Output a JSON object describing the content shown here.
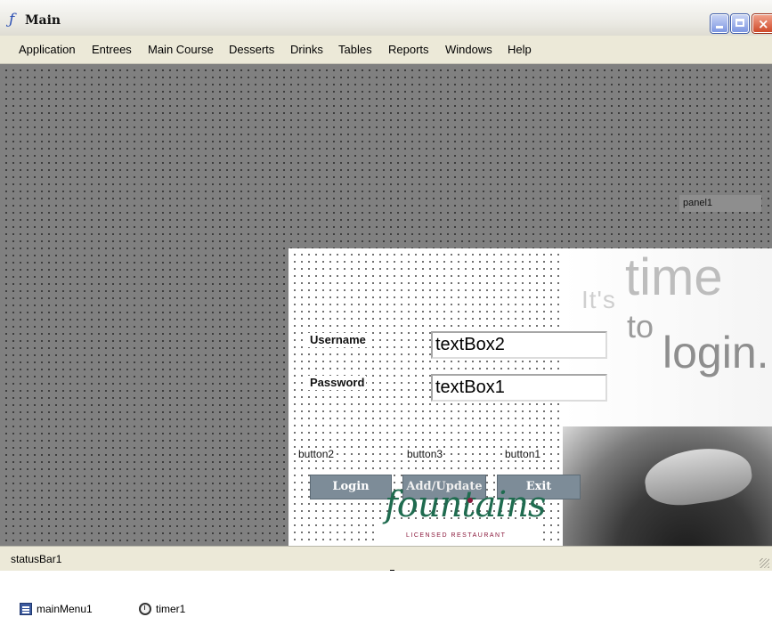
{
  "window": {
    "title": "Main",
    "app_icon_glyph": "ƒ",
    "controls": {
      "minimize": "minimize-icon",
      "maximize": "maximize-icon",
      "close": "close-icon",
      "close_glyph": "×"
    }
  },
  "menu": {
    "items": [
      "Application",
      "Entrees",
      "Main Course",
      "Desserts",
      "Drinks",
      "Tables",
      "Reports",
      "Windows",
      "Help"
    ]
  },
  "surface": {
    "panel1_label": "panel1"
  },
  "login": {
    "username_label": "Username",
    "username_value": "textBox2",
    "password_label": "Password",
    "password_value": "textBox1",
    "button_captions": [
      "button2",
      "button3",
      "button1"
    ],
    "buttons": {
      "login": "Login",
      "add_update": "Add/Update",
      "exit": "Exit"
    },
    "artwork": {
      "its": "It's",
      "time": "time",
      "to": "to",
      "login": "login."
    },
    "logo": {
      "name": "fountains",
      "tagline": "LICENSED RESTAURANT"
    }
  },
  "statusbar": {
    "text": "statusBar1"
  },
  "tray": {
    "components": [
      "mainMenu1",
      "timer1"
    ]
  },
  "colors": {
    "surface": "#808080",
    "menubar": "#ece9d8",
    "button": "#7d8c98",
    "logo_green": "#1f6b4f",
    "logo_red": "#8b1a3d",
    "close": "#cf4a2a"
  }
}
